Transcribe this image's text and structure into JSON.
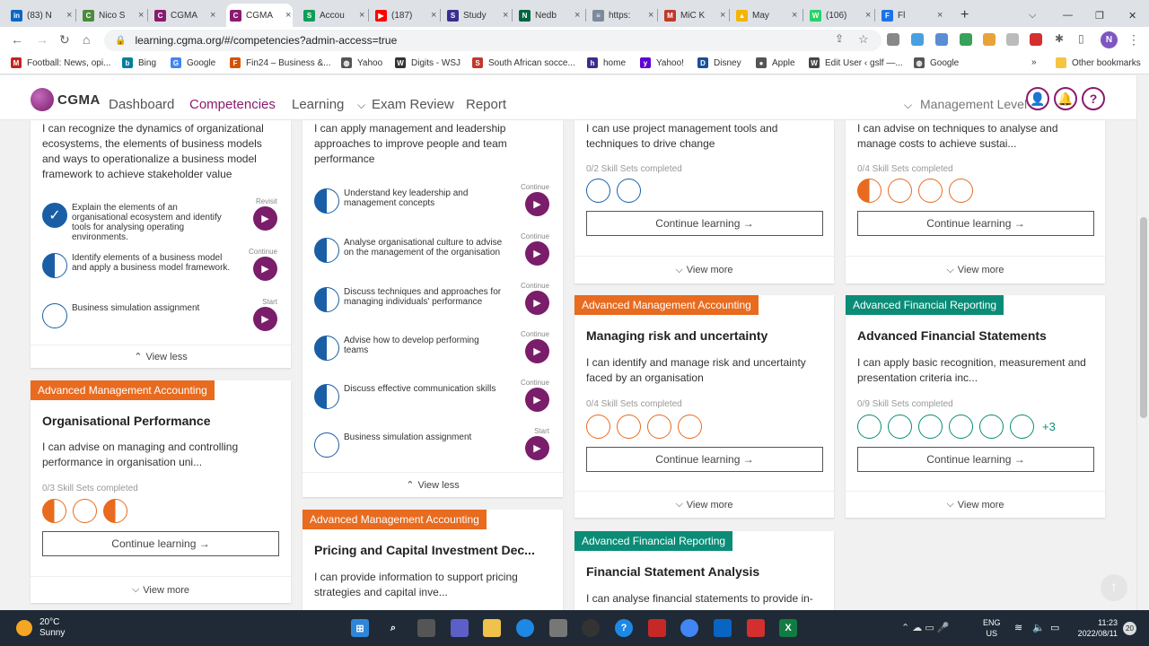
{
  "browser": {
    "tabs": [
      {
        "title": "(83) N",
        "icon": "linkedin-icon",
        "color": "#0a66c2",
        "glyph": "in"
      },
      {
        "title": "Nico S",
        "icon": "chrome-icon",
        "color": "#4b8b3b",
        "glyph": "C"
      },
      {
        "title": "CGMA",
        "icon": "cgma-icon",
        "color": "#8a1b6f",
        "glyph": "C"
      },
      {
        "title": "CGMA",
        "icon": "cgma-icon",
        "color": "#8a1b6f",
        "glyph": "C",
        "active": true
      },
      {
        "title": "Accou",
        "icon": "sheets-icon",
        "color": "#0f9d58",
        "glyph": "S"
      },
      {
        "title": "(187)",
        "icon": "youtube-icon",
        "color": "#ff0000",
        "glyph": "▶"
      },
      {
        "title": "Study",
        "icon": "study-icon",
        "color": "#3b2e8f",
        "glyph": "S"
      },
      {
        "title": "Nedb",
        "icon": "nedbank-icon",
        "color": "#006341",
        "glyph": "N"
      },
      {
        "title": "https:",
        "icon": "page-icon",
        "color": "#7c8a99",
        "glyph": "≡"
      },
      {
        "title": "MiC K",
        "icon": "mic-icon",
        "color": "#c0392b",
        "glyph": "M"
      },
      {
        "title": "May",
        "icon": "drive-icon",
        "color": "#f4b400",
        "glyph": "▲"
      },
      {
        "title": "(106)",
        "icon": "whatsapp-icon",
        "color": "#25d366",
        "glyph": "W"
      },
      {
        "title": "Fl",
        "icon": "meet-icon",
        "color": "#1a73e8",
        "glyph": "F"
      }
    ],
    "url": "learning.cgma.org/#/competencies?admin-access=true",
    "profile_initial": "N",
    "bookmarks": [
      {
        "label": "Football: News, opi...",
        "icon": "gmail-icon",
        "color": "#c5221f",
        "glyph": "M"
      },
      {
        "label": "Bing",
        "icon": "bing-icon",
        "color": "#00809d",
        "glyph": "b"
      },
      {
        "label": "Google",
        "icon": "google-icon",
        "color": "#4285f4",
        "glyph": "G"
      },
      {
        "label": "Fin24 – Business &...",
        "icon": "fin24-icon",
        "color": "#d35400",
        "glyph": "F"
      },
      {
        "label": "Yahoo",
        "icon": "globe-icon",
        "color": "#555555",
        "glyph": "◍"
      },
      {
        "label": "Digits - WSJ",
        "icon": "wsj-icon",
        "color": "#333333",
        "glyph": "W"
      },
      {
        "label": "South African socce...",
        "icon": "sl-icon",
        "color": "#c0392b",
        "glyph": "S"
      },
      {
        "label": "home",
        "icon": "home-icon",
        "color": "#3b2e8f",
        "glyph": "h"
      },
      {
        "label": "Yahoo!",
        "icon": "yahoo-icon",
        "color": "#6001d2",
        "glyph": "y"
      },
      {
        "label": "Disney",
        "icon": "disney-icon",
        "color": "#1b4e9b",
        "glyph": "D"
      },
      {
        "label": "Apple",
        "icon": "apple-icon",
        "color": "#555555",
        "glyph": "●"
      },
      {
        "label": "Edit User ‹ gslf —...",
        "icon": "wordpress-icon",
        "color": "#464646",
        "glyph": "W"
      },
      {
        "label": "Google",
        "icon": "globe-icon",
        "color": "#555555",
        "glyph": "◍"
      }
    ],
    "other_bookmarks": "Other bookmarks"
  },
  "header": {
    "logo_text": "CGMA",
    "nav": [
      "Dashboard",
      "Competencies",
      "Learning",
      "Exam Review",
      "Report"
    ],
    "management_level": "Management Level"
  },
  "cards": {
    "c1": {
      "desc": "I can recognize the dynamics of organizational ecosystems, the elements of business models and ways to operationalize a business model framework to achieve stakeholder value",
      "items": [
        {
          "text": "Explain the elements of an organisational ecosystem and identify tools for analysing operating environments.",
          "status": "Revisit"
        },
        {
          "text": "Identify elements of a business model and apply a business model framework.",
          "status": "Continue"
        },
        {
          "text": "Business simulation assignment",
          "status": "Start"
        }
      ],
      "view": "View less"
    },
    "c2": {
      "desc": "I can apply management and leadership approaches to improve people and team performance",
      "items": [
        {
          "text": "Understand key leadership and management concepts",
          "status": "Continue"
        },
        {
          "text": "Analyse organisational culture to advise on the management of the organisation",
          "status": "Continue"
        },
        {
          "text": "Discuss techniques and approaches for managing individuals' performance",
          "status": "Continue"
        },
        {
          "text": "Advise how to develop performing teams",
          "status": "Continue"
        },
        {
          "text": "Discuss effective communication skills",
          "status": "Continue"
        },
        {
          "text": "Business simulation assignment",
          "status": "Start"
        }
      ],
      "view": "View less"
    },
    "c3": {
      "desc": "I can use project management tools and techniques to drive change",
      "skills": "0/2 Skill Sets completed",
      "cont": "Continue learning →",
      "view": "View more"
    },
    "c4": {
      "desc": "I can advise on techniques to analyse and manage costs to achieve sustai...",
      "skills": "0/4 Skill Sets completed",
      "cont": "Continue learning →",
      "view": "View more"
    },
    "c5": {
      "tag": "Advanced Management Accounting",
      "title": "Organisational Performance",
      "desc": "I can advise on managing and controlling performance in organisation uni...",
      "skills": "0/3 Skill Sets completed",
      "cont": "Continue learning →",
      "view": "View more"
    },
    "c6": {
      "tag": "Advanced Management Accounting",
      "title": "Pricing and Capital Investment Dec...",
      "desc": "I can provide information to support pricing strategies and capital inve..."
    },
    "c7": {
      "tag": "Advanced Management Accounting",
      "title": "Managing risk and uncertainty",
      "desc": "I can identify and manage risk and uncertainty faced by an organisation",
      "skills": "0/4 Skill Sets completed",
      "cont": "Continue learning →",
      "view": "View more"
    },
    "c8": {
      "tag": "Advanced Financial Reporting",
      "title": "Advanced Financial Statements",
      "desc": "I can apply basic recognition, measurement and presentation criteria inc...",
      "skills": "0/9 Skill Sets completed",
      "more_count": "+3",
      "cont": "Continue learning →",
      "view": "View more"
    },
    "c9": {
      "tag": "Advanced Financial Reporting",
      "title": "Financial Statement Analysis",
      "desc": "I can analyse financial statements to provide in-"
    }
  },
  "taskbar": {
    "temp": "20°C",
    "weather": "Sunny",
    "lang1": "ENG",
    "lang2": "US",
    "time": "11:23",
    "date": "2022/08/11",
    "notifications": "20"
  }
}
